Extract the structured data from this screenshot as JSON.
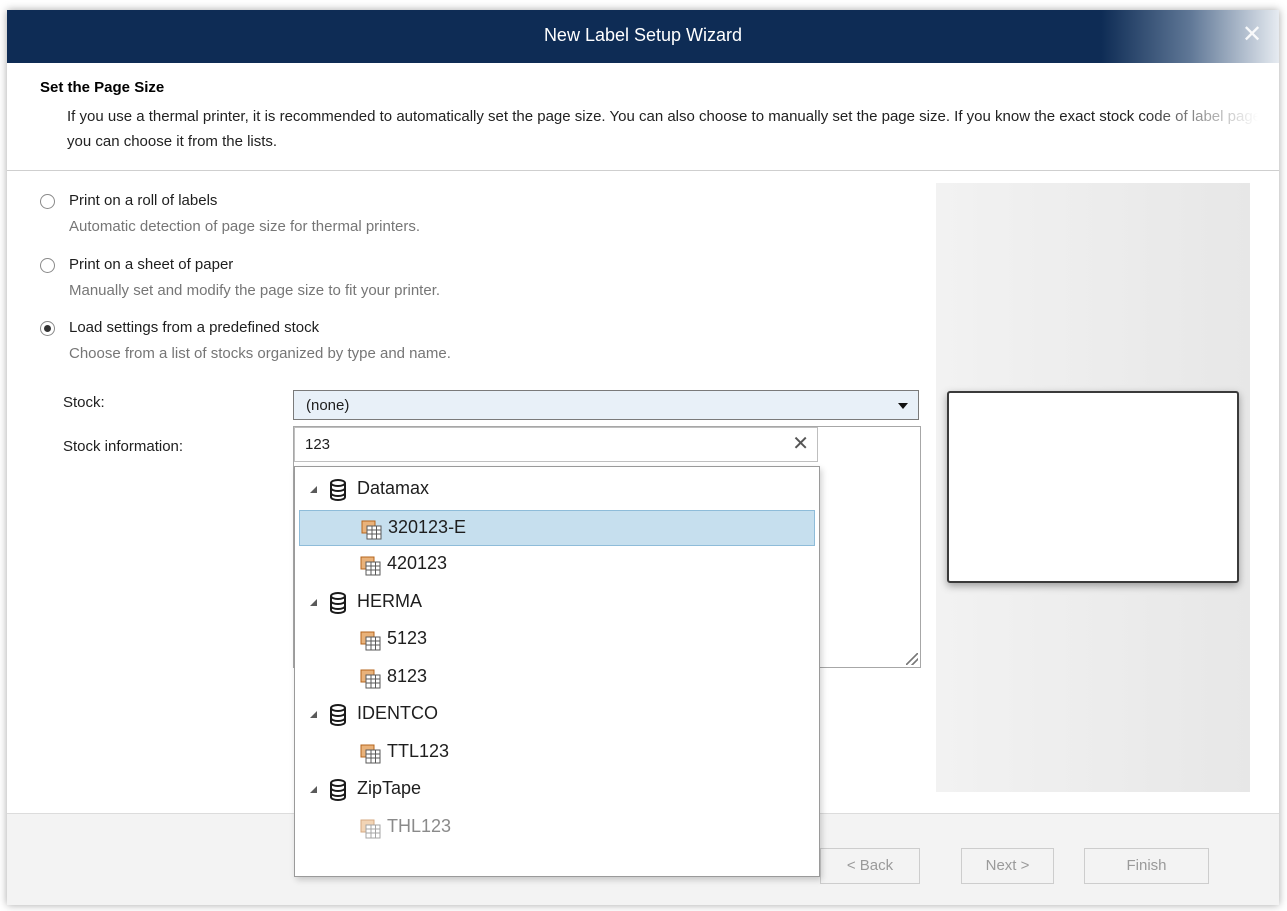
{
  "window": {
    "title": "New Label Setup Wizard",
    "close_glyph": "✕"
  },
  "header": {
    "title": "Set the Page Size",
    "description": "If you use a thermal printer, it is recommended to automatically set the page size. You can also choose to manually set the page size. If you know the exact stock code of label page, you can choose it from the lists."
  },
  "options": [
    {
      "label": "Print on a roll of labels",
      "description": "Automatic detection of page size for thermal printers.",
      "checked": false
    },
    {
      "label": "Print on a sheet of paper",
      "description": "Manually set and modify the page size to fit your printer.",
      "checked": false
    },
    {
      "label": "Load settings from a predefined stock",
      "description": "Choose from a list of stocks organized by type and name.",
      "checked": true
    }
  ],
  "stock": {
    "label": "Stock:",
    "value": "(none)"
  },
  "stock_info": {
    "label": "Stock information:"
  },
  "search": {
    "value": "123",
    "clear_glyph": "✕"
  },
  "tree": {
    "groups": [
      {
        "name": "Datamax",
        "items": [
          {
            "name": "320123-E",
            "selected": true
          },
          {
            "name": "420123"
          }
        ]
      },
      {
        "name": "HERMA",
        "items": [
          {
            "name": "5123"
          },
          {
            "name": "8123"
          }
        ]
      },
      {
        "name": "IDENTCO",
        "items": [
          {
            "name": "TTL123"
          }
        ]
      },
      {
        "name": "ZipTape",
        "items": [
          {
            "name": "THL123",
            "dim": true
          }
        ]
      }
    ]
  },
  "buttons": {
    "back": "< Back",
    "next": "Next >",
    "finish": "Finish"
  },
  "colors": {
    "titlebar": "#0e2c55",
    "selection": "#c6dfee",
    "selection_border": "#8ebcd9",
    "db_icon": "#1a1a1a",
    "stock_icon": "#b5651d"
  }
}
